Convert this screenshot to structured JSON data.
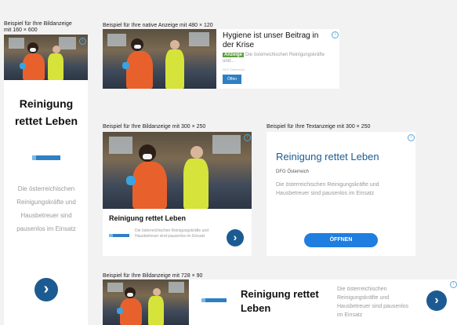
{
  "captions": {
    "c160": "Beispiel für Ihre Bildanzeige\nmit 160 × 600",
    "native": "Beispiel für Ihre native Anzeige mit 480 × 120",
    "img300": "Beispiel für Ihre Bildanzeige mit 300 × 250",
    "text300": "Beispiel für Ihre Textanzeige mit 300 × 250",
    "img728": "Beispiel für Ihre Bildanzeige mit 728 × 90"
  },
  "skyscraper": {
    "headline": "Reinigung rettet Leben",
    "body": "Die österreichischen Reinigungskräfte und Hausbetreuer sind pausenlos im Einsatz",
    "button": "›"
  },
  "native": {
    "headline": "Hygiene ist unser Beitrag in der Krise",
    "badge": "Anzeige",
    "body": "Die österreichischen Reinigungskräfte und...",
    "advertiser": "DFG Österreich",
    "button": "Öffen"
  },
  "image300": {
    "headline": "Reinigung rettet Leben",
    "body": "Die österreichischen Reinigungskräfte und Hausbetreuer sind pausenlos im Einsatz",
    "button": "›"
  },
  "text300": {
    "headline": "Reinigung rettet Leben",
    "advertiser": "DFG Österreich",
    "body": "Die österreichischen Reinigungskräfte und Hausbetreuer sind pausenlos im Einsatz",
    "button": "ÖFFNEN"
  },
  "leader": {
    "headline": "Reinigung rettet Leben",
    "body": "Die österreichischen Reinigungskräfte und Hausbetreuer sind pausenlos im Einsatz",
    "button": "›"
  },
  "icons": {
    "adchoices": "info-icon",
    "arrow": "chevron-right-icon"
  },
  "colors": {
    "accent": "#1c5b92",
    "cta": "#1f7ee0",
    "logo": "#2f7fc4"
  }
}
